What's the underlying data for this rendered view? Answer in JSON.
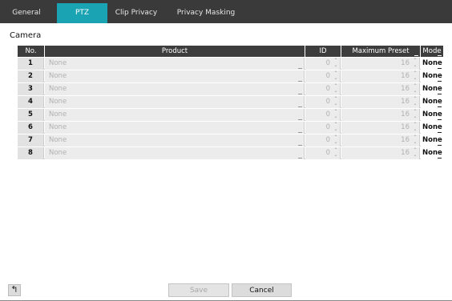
{
  "tabs": [
    {
      "label": "General",
      "active": false
    },
    {
      "label": "PTZ",
      "active": true
    },
    {
      "label": "Clip Privacy",
      "active": false
    },
    {
      "label": "Privacy Masking",
      "active": false
    }
  ],
  "section_title": "Camera",
  "table": {
    "headers": {
      "no": "No.",
      "product": "Product",
      "id": "ID",
      "max_preset": "Maximum Preset",
      "mode": "Mode"
    },
    "rows": [
      {
        "no": "1",
        "product": "None",
        "id": "0",
        "max_preset": "16",
        "mode": "None"
      },
      {
        "no": "2",
        "product": "None",
        "id": "0",
        "max_preset": "16",
        "mode": "None"
      },
      {
        "no": "3",
        "product": "None",
        "id": "0",
        "max_preset": "16",
        "mode": "None"
      },
      {
        "no": "4",
        "product": "None",
        "id": "0",
        "max_preset": "16",
        "mode": "None"
      },
      {
        "no": "5",
        "product": "None",
        "id": "0",
        "max_preset": "16",
        "mode": "None"
      },
      {
        "no": "6",
        "product": "None",
        "id": "0",
        "max_preset": "16",
        "mode": "None"
      },
      {
        "no": "7",
        "product": "None",
        "id": "0",
        "max_preset": "16",
        "mode": "None"
      },
      {
        "no": "8",
        "product": "None",
        "id": "0",
        "max_preset": "16",
        "mode": "None"
      }
    ]
  },
  "buttons": {
    "save": "Save",
    "cancel": "Cancel",
    "back_icon": "back-arrow-icon"
  },
  "colors": {
    "accent": "#1aa3b3",
    "tabbar": "#3a3a3a",
    "header": "#3d3d3d"
  }
}
